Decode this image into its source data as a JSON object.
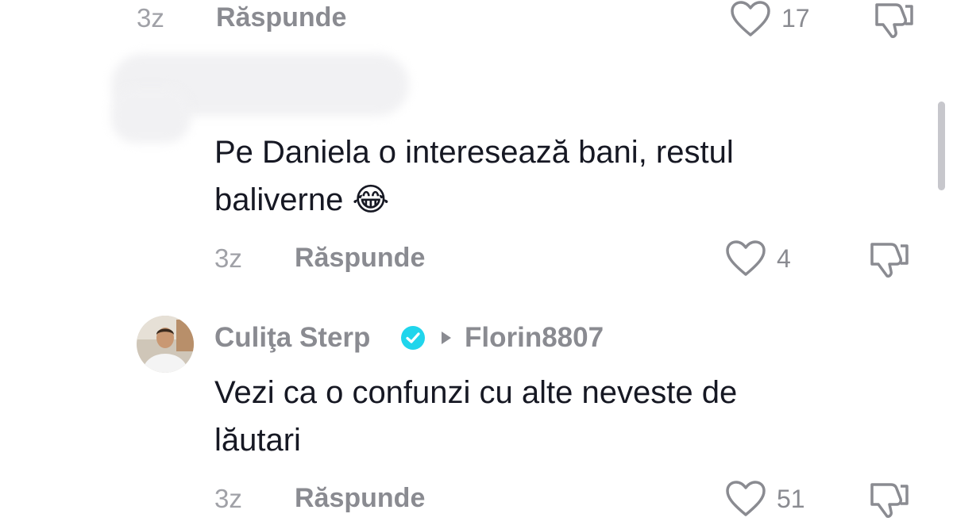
{
  "comments": [
    {
      "time": "3z",
      "reply_label": "Răspunde",
      "likes": "17"
    },
    {
      "username": "",
      "text_line1": "Pe Daniela o interesează bani, restul",
      "text_line2": "baliverne",
      "emoji": "😂",
      "time": "3z",
      "reply_label": "Răspunde",
      "likes": "4"
    },
    {
      "username": "Culiţa Sterp",
      "verified": true,
      "reply_to": "Florin8807",
      "text_line1": "Vezi ca o confunzi cu alte neveste de",
      "text_line2": "lăutari",
      "time": "3z",
      "reply_label": "Răspunde",
      "likes": "51"
    }
  ],
  "icons": {
    "like": "heart-outline-icon",
    "dislike": "thumbs-down-outline-icon",
    "verified": "verified-badge-icon",
    "reply_arrow": "play-triangle-icon"
  },
  "colors": {
    "verified": "#20d5ec",
    "text": "#161823",
    "muted": "#8a8b91"
  }
}
